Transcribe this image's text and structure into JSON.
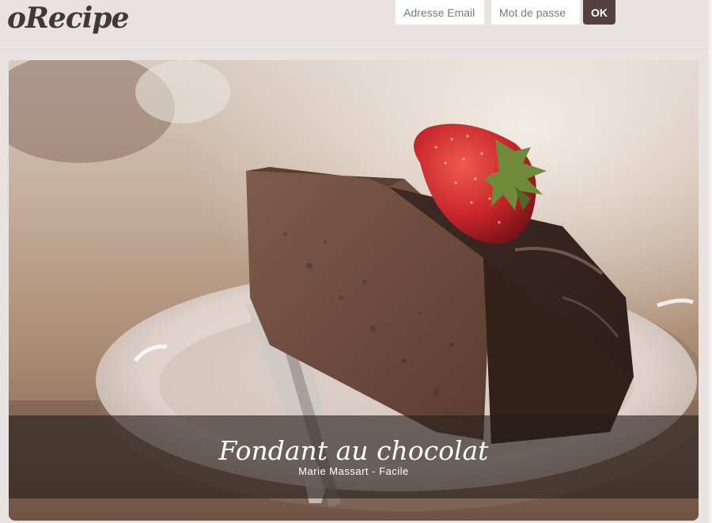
{
  "header": {
    "logo": "oRecipe",
    "login": {
      "email_placeholder": "Adresse Email",
      "password_placeholder": "Mot de passe",
      "submit_label": "OK"
    }
  },
  "hero": {
    "title": "Fondant au chocolat",
    "author": "Marie Massart",
    "separator": " - ",
    "difficulty": "Facile"
  },
  "colors": {
    "page_background": "#e8e2e1",
    "logo_text": "#3f3a39",
    "ok_button": "#54413f",
    "caption_overlay": "rgba(38,30,28,0.62)"
  }
}
